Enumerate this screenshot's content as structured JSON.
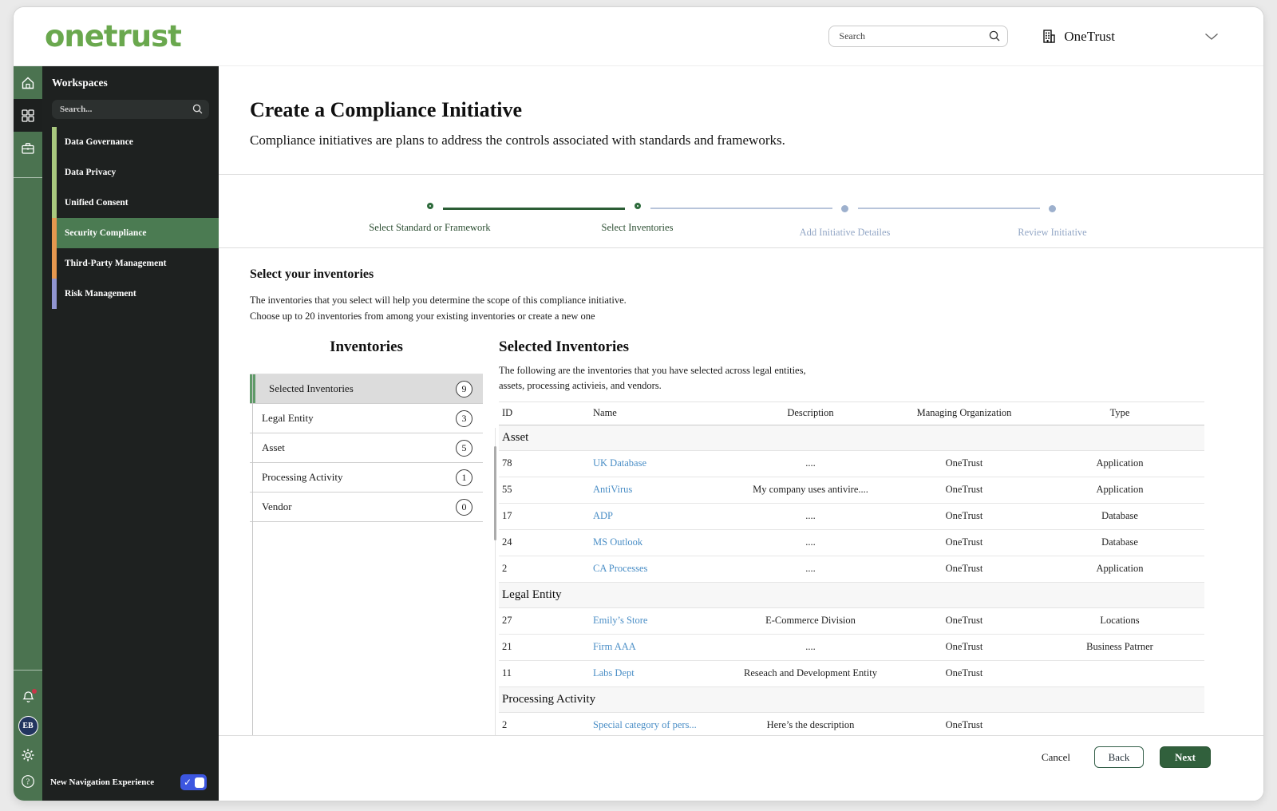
{
  "header": {
    "logo": "onetrust",
    "search_placeholder": "Search",
    "tenant": "OneTrust"
  },
  "sidebar": {
    "workspaces": {
      "title": "Workspaces",
      "search_placeholder": "Search...",
      "items": [
        {
          "label": "Data Governance",
          "strip_color": "#a9c87e",
          "selected": false
        },
        {
          "label": "Data Privacy",
          "strip_color": "#a9c87e",
          "selected": false
        },
        {
          "label": "Unified Consent",
          "strip_color": "#a9c87e",
          "selected": false
        },
        {
          "label": "Security Compliance",
          "strip_color": "#e6984f",
          "selected": true
        },
        {
          "label": "Third-Party Management",
          "strip_color": "#e6984f",
          "selected": false
        },
        {
          "label": "Risk Management",
          "strip_color": "#9095d0",
          "selected": false
        }
      ],
      "selected_bg_color": "#4b7b52"
    },
    "avatar_initials": "EB",
    "new_nav": {
      "label": "New Navigation Experience",
      "enabled": true,
      "toggle_color": "#3c56e0"
    }
  },
  "page": {
    "title": "Create a Compliance Initiative",
    "subtitle": "Compliance initiatives are plans to address the controls associated with standards and frameworks."
  },
  "stepper": {
    "steps": [
      {
        "label": "Select Standard or Framework",
        "state": "complete"
      },
      {
        "label": "Select Inventories",
        "state": "active"
      },
      {
        "label": "Add Initiative Detailes",
        "state": "upcoming"
      },
      {
        "label": "Review Initiative",
        "state": "upcoming"
      }
    ],
    "active_color": "#2e6b3c",
    "upcoming_color": "#9db0cd"
  },
  "section": {
    "heading": "Select your inventories",
    "description_line1": "The inventories that you select will help you determine the scope of this compliance initiative.",
    "description_line2": "Choose up to 20 inventories from among your existing inventories or create a new one"
  },
  "inventories_panel": {
    "title": "Inventories",
    "items": [
      {
        "label": "Selected Inventories",
        "count": 9,
        "selected": true
      },
      {
        "label": "Legal Entity",
        "count": 3,
        "selected": false
      },
      {
        "label": "Asset",
        "count": 5,
        "selected": false
      },
      {
        "label": "Processing Activity",
        "count": 1,
        "selected": false
      },
      {
        "label": "Vendor",
        "count": 0,
        "selected": false
      }
    ]
  },
  "selected_inventories": {
    "title": "Selected Inventories",
    "description_line1": "The following are the inventories that you have selected across legal entities,",
    "description_line2": "assets, processing activieis, and vendors.",
    "columns": [
      "ID",
      "Name",
      "Description",
      "Managing Organization",
      "Type"
    ],
    "link_color": "#4a8ec6",
    "groups": [
      {
        "name": "Asset",
        "rows": [
          {
            "id": "78",
            "name": "UK Database",
            "description": "....",
            "org": "OneTrust",
            "type": "Application"
          },
          {
            "id": "55",
            "name": "AntiVirus",
            "description": "My company uses antivire....",
            "org": "OneTrust",
            "type": "Application"
          },
          {
            "id": "17",
            "name": "ADP",
            "description": "....",
            "org": "OneTrust",
            "type": "Database"
          },
          {
            "id": "24",
            "name": "MS Outlook",
            "description": "....",
            "org": "OneTrust",
            "type": "Database"
          },
          {
            "id": "2",
            "name": "CA Processes",
            "description": "....",
            "org": "OneTrust",
            "type": "Application"
          }
        ]
      },
      {
        "name": "Legal Entity",
        "rows": [
          {
            "id": "27",
            "name": "Emily’s Store",
            "description": "E-Commerce Division",
            "org": "OneTrust",
            "type": "Locations"
          },
          {
            "id": "21",
            "name": "Firm AAA",
            "description": "....",
            "org": "OneTrust",
            "type": "Business Patrner"
          },
          {
            "id": "11",
            "name": "Labs Dept",
            "description": "Reseach and Development Entity",
            "org": "OneTrust",
            "type": ""
          }
        ]
      },
      {
        "name": "Processing Activity",
        "rows": [
          {
            "id": "2",
            "name": "Special category of pers...",
            "description": "Here’s the description",
            "org": "OneTrust",
            "type": ""
          }
        ]
      }
    ]
  },
  "footer": {
    "cancel_label": "Cancel",
    "back_label": "Back",
    "next_label": "Next"
  }
}
